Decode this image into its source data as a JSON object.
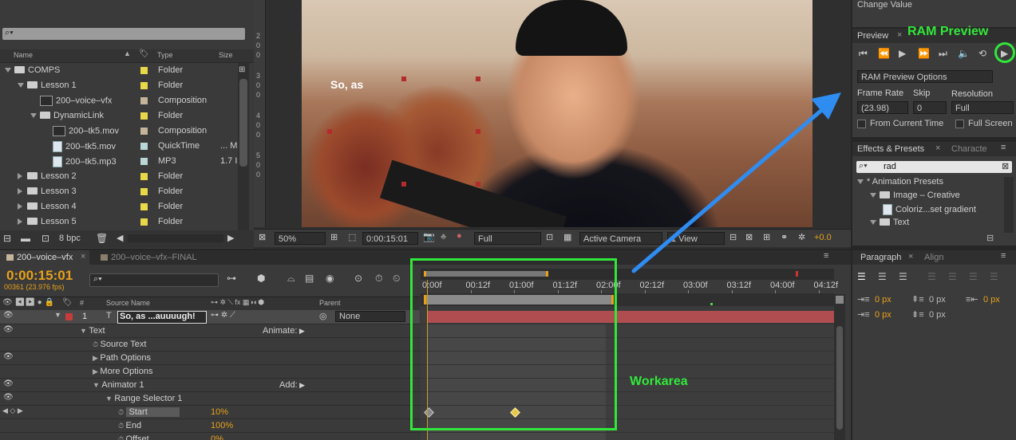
{
  "project": {
    "columns": {
      "name": "Name",
      "type": "Type",
      "size": "Size"
    },
    "items": [
      {
        "name": "COMPS",
        "type": "Folder",
        "size": "",
        "indent": 0,
        "kind": "folder",
        "color": "#e8d84a",
        "open": true
      },
      {
        "name": "Lesson 1",
        "type": "Folder",
        "size": "",
        "indent": 1,
        "kind": "folder",
        "color": "#e8d84a",
        "open": true
      },
      {
        "name": "200–voice–vfx",
        "type": "Composition",
        "size": "",
        "indent": 2,
        "kind": "comp",
        "color": "#c4b49a",
        "open": null
      },
      {
        "name": "DynamicLink",
        "type": "Folder",
        "size": "",
        "indent": 2,
        "kind": "folder",
        "color": "#e8d84a",
        "open": true
      },
      {
        "name": "200–tk5.mov",
        "type": "Composition",
        "size": "",
        "indent": 3,
        "kind": "comp",
        "color": "#c4b49a",
        "open": null
      },
      {
        "name": "200–tk5.mov",
        "type": "QuickTime",
        "size": "... M",
        "indent": 3,
        "kind": "file",
        "color": "#b9d7d6",
        "open": null
      },
      {
        "name": "200–tk5.mp3",
        "type": "MP3",
        "size": "1.7 I",
        "indent": 3,
        "kind": "file",
        "color": "#b9d7d6",
        "open": null
      },
      {
        "name": "Lesson 2",
        "type": "Folder",
        "size": "",
        "indent": 1,
        "kind": "folder",
        "color": "#e8d84a",
        "open": false
      },
      {
        "name": "Lesson 3",
        "type": "Folder",
        "size": "",
        "indent": 1,
        "kind": "folder",
        "color": "#e8d84a",
        "open": false
      },
      {
        "name": "Lesson 4",
        "type": "Folder",
        "size": "",
        "indent": 1,
        "kind": "folder",
        "color": "#e8d84a",
        "open": false
      },
      {
        "name": "Lesson 5",
        "type": "Folder",
        "size": "",
        "indent": 1,
        "kind": "folder",
        "color": "#e8d84a",
        "open": false
      }
    ],
    "bpc": "8 bpc"
  },
  "viewer": {
    "overlay_text": "So, as",
    "ruler_labels": [
      "2",
      "0",
      "0",
      "3",
      "0",
      "0",
      "4",
      "0",
      "0",
      "5",
      "0",
      "0"
    ],
    "zoom": "50%",
    "timecode": "0:00:15:01",
    "resolution": "Full",
    "camera": "Active Camera",
    "view": "1 View",
    "exposure": "+0.0"
  },
  "info": {
    "change_value": "Change Value"
  },
  "preview": {
    "tab": "Preview",
    "options_label": "RAM Preview Options",
    "frame_rate_label": "Frame Rate",
    "skip_label": "Skip",
    "resolution_label": "Resolution",
    "frame_rate": "(23.98)",
    "skip": "0",
    "resolution": "Full",
    "from_current": "From Current Time",
    "full_screen": "Full Screen"
  },
  "effects": {
    "tab": "Effects & Presets",
    "tab2": "Characte",
    "search": "rad",
    "tree": [
      {
        "label": "* Animation Presets",
        "indent": 0
      },
      {
        "label": "Image – Creative",
        "indent": 1
      },
      {
        "label": "Coloriz...set gradient",
        "indent": 2
      },
      {
        "label": "Text",
        "indent": 1
      }
    ]
  },
  "paragraph": {
    "tab": "Paragraph",
    "tab2": "Align",
    "values": [
      "0 px",
      "0 px",
      "0 px",
      "0 px",
      "0 px"
    ]
  },
  "timeline": {
    "tabs": [
      {
        "label": "200–voice–vfx",
        "active": true
      },
      {
        "label": "200–voice–vfx–FINAL",
        "active": false
      }
    ],
    "timecode": "0:00:15:01",
    "frames": "00361 (23.976 fps)",
    "columns": {
      "num": "#",
      "source": "Source Name",
      "parent": "Parent"
    },
    "layer": {
      "num": "1",
      "name": "So, as ...auuuugh!",
      "parent": "None"
    },
    "props": [
      {
        "label": "Text",
        "indent": 1,
        "extra": "Animate:",
        "value": ""
      },
      {
        "label": "Source Text",
        "indent": 2,
        "extra": "",
        "value": ""
      },
      {
        "label": "Path Options",
        "indent": 2,
        "extra": "",
        "value": ""
      },
      {
        "label": "More Options",
        "indent": 2,
        "extra": "",
        "value": ""
      },
      {
        "label": "Animator 1",
        "indent": 2,
        "extra": "Add:",
        "value": ""
      },
      {
        "label": "Range Selector 1",
        "indent": 3,
        "extra": "",
        "value": ""
      },
      {
        "label": "Start",
        "indent": 4,
        "extra": "",
        "value": "10%"
      },
      {
        "label": "End",
        "indent": 4,
        "extra": "",
        "value": "100%"
      },
      {
        "label": "Offset",
        "indent": 4,
        "extra": "",
        "value": "0%"
      }
    ],
    "ruler": [
      "0:00f",
      "00:12f",
      "01:00f",
      "01:12f",
      "02:00f",
      "02:12f",
      "03:00f",
      "03:12f",
      "04:00f",
      "04:12f"
    ]
  },
  "annotations": {
    "ram_preview": "RAM Preview",
    "workarea": "Workarea",
    "accent": "#31e83a",
    "arrow": "#2f8cf0"
  }
}
